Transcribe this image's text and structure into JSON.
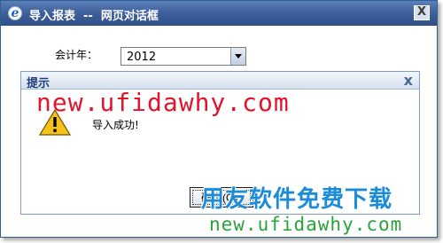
{
  "window": {
    "title": "导入报表  --  网页对话框",
    "close_label": "X",
    "browser_icon": "e"
  },
  "form": {
    "fiscal_year_label": "会计年：",
    "fiscal_year_value": "2012"
  },
  "alert": {
    "title": "提示",
    "close_label": "x",
    "icon": "warning-icon",
    "message": "导入成功!",
    "ok_label": "确定(O)"
  },
  "watermarks": {
    "top": "new.ufidawhy.com",
    "chinese": "用友软件免费下载",
    "bottom": "new.ufidawhy.com"
  },
  "colors": {
    "titlebar": "#3d5f9a",
    "watermark_red": "#e0142c",
    "watermark_blue": "#1c8cd8",
    "watermark_green": "#29a43c"
  }
}
